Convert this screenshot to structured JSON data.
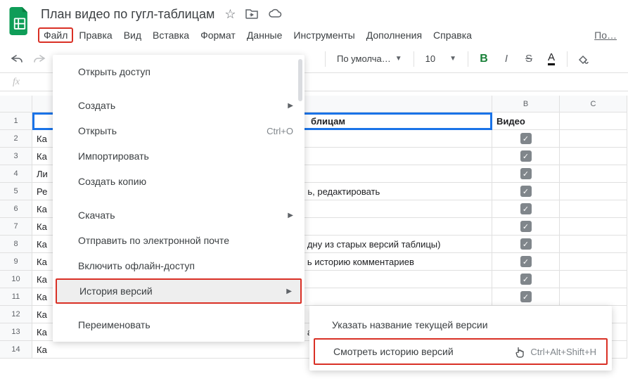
{
  "doc": {
    "title": "План видео по гугл-таблицам"
  },
  "menubar": {
    "items": [
      "Файл",
      "Правка",
      "Вид",
      "Вставка",
      "Формат",
      "Данные",
      "Инструменты",
      "Дополнения",
      "Справка"
    ],
    "cutoff": "По…"
  },
  "toolbar": {
    "font_style": "По умолча…",
    "font_size": "10",
    "letters": {
      "bold": "B",
      "italic": "I",
      "strike": "S",
      "color": "A"
    }
  },
  "fx": {
    "label": "fx"
  },
  "columns": [
    "",
    "B",
    "C"
  ],
  "rows": [
    {
      "n": "1",
      "a": "блицам",
      "b_header": "Видео",
      "header": true
    },
    {
      "n": "2",
      "a": "Ка",
      "checked": true
    },
    {
      "n": "3",
      "a": "Ка",
      "checked": true
    },
    {
      "n": "4",
      "a": "Ли",
      "checked": true
    },
    {
      "n": "5",
      "a": "Ре",
      "a_tail": "ь, редактировать",
      "checked": true
    },
    {
      "n": "6",
      "a": "Ка",
      "checked": true
    },
    {
      "n": "7",
      "a": "Ка",
      "checked": true
    },
    {
      "n": "8",
      "a": "Ка",
      "a_tail": "дну из старых версий таблицы)",
      "checked": true
    },
    {
      "n": "9",
      "a": "Ка",
      "a_tail": "ь историю комментариев",
      "checked": true
    },
    {
      "n": "10",
      "a": "Ка",
      "checked": true
    },
    {
      "n": "11",
      "a": "Ка",
      "checked": true
    },
    {
      "n": "12",
      "a": "Ка",
      "checked": true
    },
    {
      "n": "13",
      "a": "Ка",
      "a_tail": "атуро)",
      "checked": true
    },
    {
      "n": "14",
      "a": "Ка",
      "checked": true
    }
  ],
  "file_menu": {
    "share": "Открыть доступ",
    "new": "Создать",
    "open": "Открыть",
    "open_shortcut": "Ctrl+O",
    "import": "Импортировать",
    "copy": "Создать копию",
    "download": "Скачать",
    "email": "Отправить по электронной почте",
    "offline": "Включить офлайн-доступ",
    "version_history": "История версий",
    "rename": "Переименовать"
  },
  "submenu": {
    "name_current": "Указать название текущей версии",
    "see_history": "Смотреть историю версий",
    "see_history_shortcut": "Ctrl+Alt+Shift+H"
  }
}
